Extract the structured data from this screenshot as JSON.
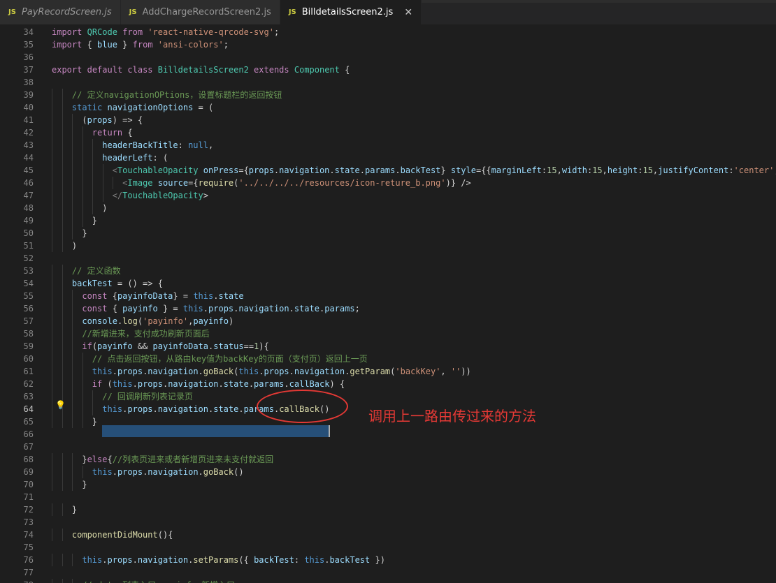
{
  "tabs": [
    {
      "icon": "JS",
      "label": "PayRecordScreen.js",
      "italic": true,
      "active": false
    },
    {
      "icon": "JS",
      "label": "AddChargeRecordScreen2.js",
      "italic": false,
      "active": false
    },
    {
      "icon": "JS",
      "label": "BilldetailsScreen2.js",
      "italic": false,
      "active": true,
      "close": "✕"
    }
  ],
  "lines": [
    {
      "n": "34",
      "t": "import QRCode from 'react-native-qrcode-svg';"
    },
    {
      "n": "35",
      "t": "import { blue } from 'ansi-colors';"
    },
    {
      "n": "36",
      "t": ""
    },
    {
      "n": "37",
      "t": "export default class BilldetailsScreen2 extends Component {"
    },
    {
      "n": "38",
      "t": ""
    },
    {
      "n": "39",
      "t": "    // 定义navigationOPtions，设置标题栏的返回按钮"
    },
    {
      "n": "40",
      "t": "    static navigationOptions = ("
    },
    {
      "n": "41",
      "t": "      (props) => {"
    },
    {
      "n": "42",
      "t": "        return {"
    },
    {
      "n": "43",
      "t": "          headerBackTitle: null,"
    },
    {
      "n": "44",
      "t": "          headerLeft: ("
    },
    {
      "n": "45",
      "t": "            <TouchableOpacity onPress={props.navigation.state.params.backTest} style={{marginLeft:15,width:15,height:15,justifyContent:'center',"
    },
    {
      "n": "46",
      "t": "              <Image source={require('../../../../resources/icon-reture_b.png')} />"
    },
    {
      "n": "47",
      "t": "            </TouchableOpacity>"
    },
    {
      "n": "48",
      "t": "          )"
    },
    {
      "n": "49",
      "t": "        }"
    },
    {
      "n": "50",
      "t": "      }"
    },
    {
      "n": "51",
      "t": "    )"
    },
    {
      "n": "52",
      "t": ""
    },
    {
      "n": "53",
      "t": "    // 定义函数"
    },
    {
      "n": "54",
      "t": "    backTest = () => {"
    },
    {
      "n": "55",
      "t": "      const {payinfoData} = this.state"
    },
    {
      "n": "56",
      "t": "      const { payinfo } = this.props.navigation.state.params;"
    },
    {
      "n": "57",
      "t": "      console.log('payinfo',payinfo)"
    },
    {
      "n": "58",
      "t": "      //新增进来，支付成功刷新页面后"
    },
    {
      "n": "59",
      "t": "      if(payinfo && payinfoData.status==1){"
    },
    {
      "n": "60",
      "t": "        // 点击返回按钮，从路由key值为backKey的页面（支付页）返回上一页"
    },
    {
      "n": "61",
      "t": "        this.props.navigation.goBack(this.props.navigation.getParam('backKey', ''))"
    },
    {
      "n": "62",
      "t": "        if (this.props.navigation.state.params.callBack) {"
    },
    {
      "n": "63",
      "t": "          // 回调刷新列表记录页"
    },
    {
      "n": "64",
      "t": "          this.props.navigation.state.params.callBack()"
    },
    {
      "n": "65",
      "t": "        }"
    },
    {
      "n": "66",
      "t": ""
    },
    {
      "n": "67",
      "t": ""
    },
    {
      "n": "68",
      "t": "      }else{//列表页进来或者新增页进来未支付就返回"
    },
    {
      "n": "69",
      "t": "        this.props.navigation.goBack()"
    },
    {
      "n": "70",
      "t": "      }"
    },
    {
      "n": "71",
      "t": ""
    },
    {
      "n": "72",
      "t": "    }"
    },
    {
      "n": "73",
      "t": ""
    },
    {
      "n": "74",
      "t": "    componentDidMount(){"
    },
    {
      "n": "75",
      "t": ""
    },
    {
      "n": "76",
      "t": "      this.props.navigation.setParams({ backTest: this.backTest })"
    },
    {
      "n": "77",
      "t": ""
    },
    {
      "n": "78",
      "t": "      // data 列表入口 payinfo 新增入口"
    }
  ],
  "annotation": "调用上一路由传过来的方法",
  "colors": {
    "editor_bg": "#1e1e1e",
    "selection": "#264f78",
    "annotation": "#e53935",
    "keyword": "#c586c0",
    "comment": "#6a9955",
    "string": "#ce9178"
  }
}
